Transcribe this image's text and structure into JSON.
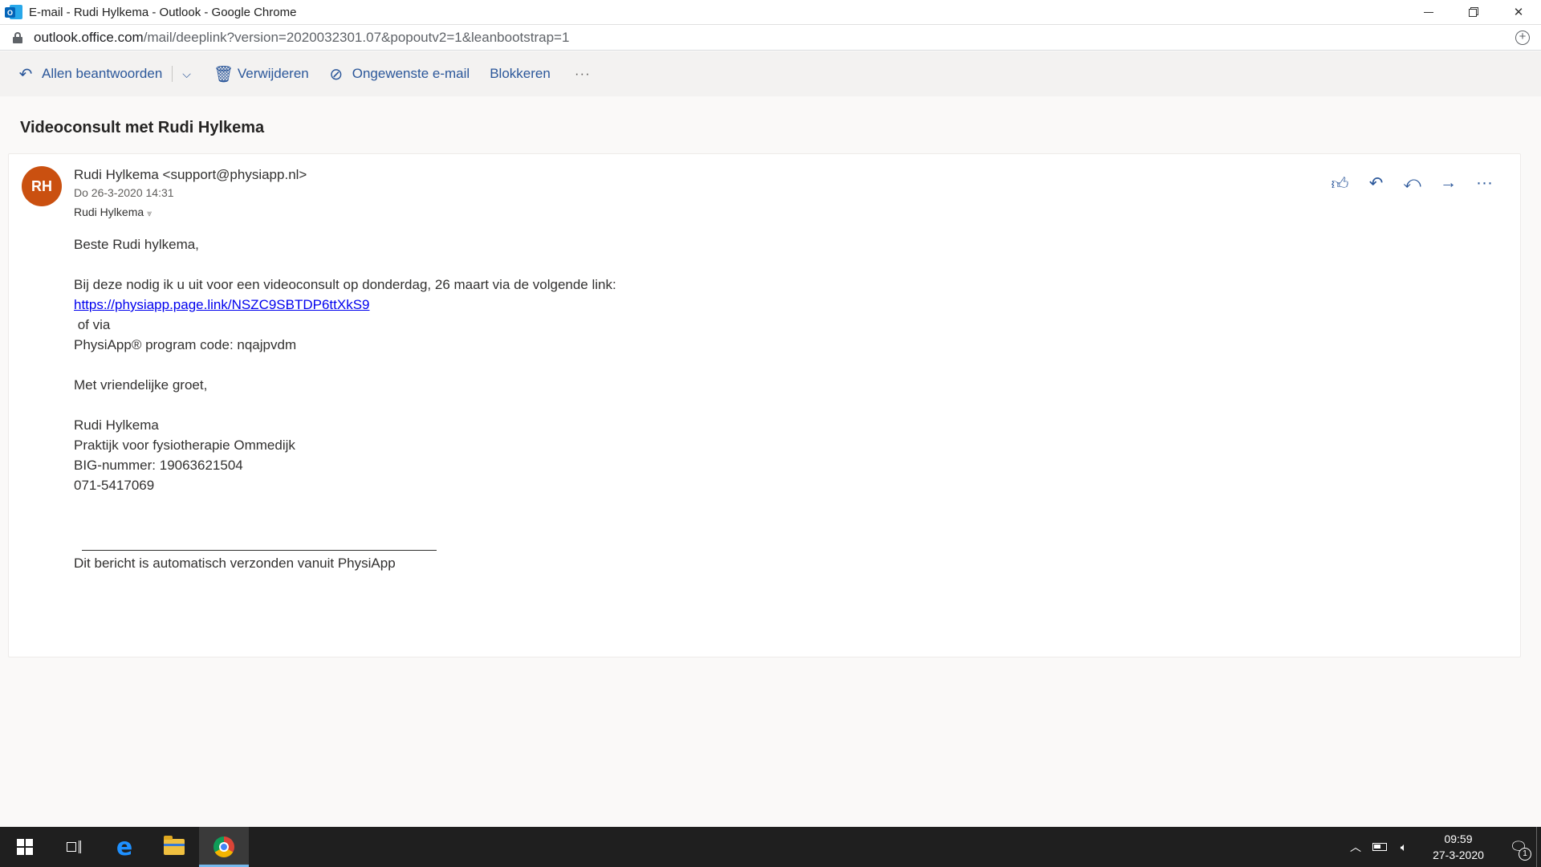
{
  "window": {
    "title": "E-mail - Rudi Hylkema - Outlook - Google Chrome",
    "url_host": "outlook.office.com",
    "url_path": "/mail/deeplink?version=2020032301.07&popoutv2=1&leanbootstrap=1"
  },
  "toolbar": {
    "reply_all": "Allen beantwoorden",
    "delete": "Verwijderen",
    "junk": "Ongewenste e-mail",
    "block": "Blokkeren",
    "more": "···"
  },
  "message": {
    "subject": "Videoconsult met Rudi Hylkema",
    "avatar_initials": "RH",
    "avatar_color": "#ca5010",
    "sender": "Rudi Hylkema <support@physiapp.nl>",
    "date": "Do 26-3-2020 14:31",
    "recipient": "Rudi Hylkema",
    "actions": [
      "like-icon",
      "reply-icon",
      "reply-all-icon",
      "forward-icon",
      "more-icon"
    ],
    "body": {
      "greeting": "Beste Rudi hylkema,",
      "invite": "Bij deze nodig ik u uit voor een videoconsult op donderdag, 26 maart via de volgende link:",
      "link": "https://physiapp.page.link/NSZC9SBTDP6ttXkS9",
      "or_via": " of via",
      "program_code": "PhysiApp® program code: nqajpvdm",
      "closing": "Met vriendelijke groet,",
      "sig_name": "Rudi Hylkema",
      "sig_practice": "Praktijk voor fysiotherapie Ommedijk",
      "sig_big": "BIG-nummer: 19063621504",
      "sig_phone": "071-5417069",
      "footer": "Dit bericht is automatisch verzonden vanuit PhysiApp"
    }
  },
  "taskbar": {
    "time": "09:59",
    "date": "27-3-2020",
    "notification_count": "1"
  },
  "colors": {
    "accent": "#2b579a",
    "link": "#0000ee"
  }
}
